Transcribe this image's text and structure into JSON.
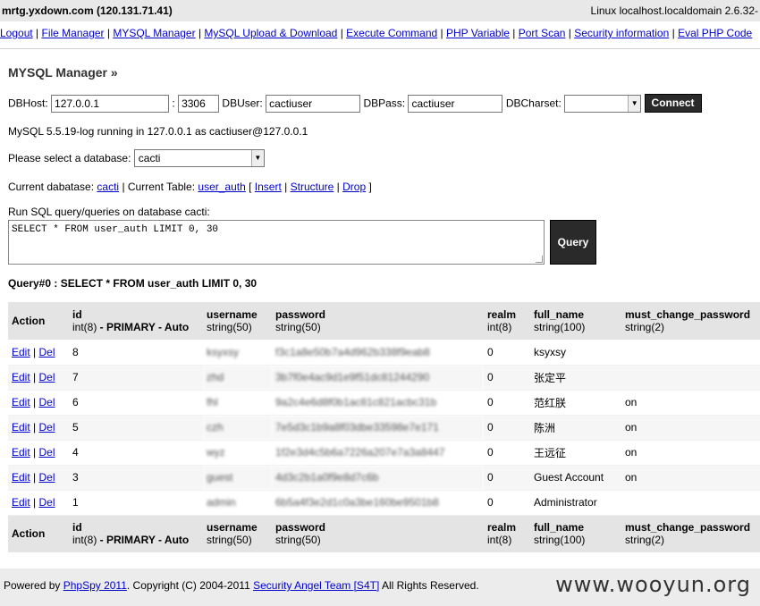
{
  "header": {
    "host": "mrtg.yxdown.com (120.131.71.41)",
    "system": "Linux localhost.localdomain 2.6.32-"
  },
  "nav": [
    "Logout",
    "File Manager",
    "MYSQL Manager",
    "MySQL Upload & Download",
    "Execute Command",
    "PHP Variable",
    "Port Scan",
    "Security information",
    "Eval PHP Code"
  ],
  "page": {
    "title": "MYSQL Manager »"
  },
  "connect": {
    "host_label": "DBHost:",
    "host_value": "127.0.0.1",
    "port_sep": ":",
    "port_value": "3306",
    "user_label": "DBUser:",
    "user_value": "cactiuser",
    "pass_label": "DBPass:",
    "pass_value": "cactiuser",
    "charset_label": "DBCharset:",
    "charset_value": "",
    "connect_button": "Connect"
  },
  "status": "MySQL 5.5.19-log running in 127.0.0.1 as cactiuser@127.0.0.1",
  "dbselect": {
    "label": "Please select a database:",
    "value": "cacti"
  },
  "current": {
    "db_prefix": "Current dabatase:",
    "db": "cacti",
    "table_prefix": "| Current Table:",
    "table": "user_auth",
    "open_bracket": "[",
    "insert": "Insert",
    "pipe1": "|",
    "structure": "Structure",
    "pipe2": "|",
    "drop": "Drop",
    "close_bracket": "]"
  },
  "query": {
    "label": "Run SQL query/queries on database cacti:",
    "text": "SELECT * FROM user_auth LIMIT 0, 30",
    "button": "Query",
    "result_title": "Query#0 : SELECT * FROM user_auth LIMIT 0, 30"
  },
  "table": {
    "action_header": "Action",
    "columns": [
      {
        "name": "id",
        "type_plain": "int(8)",
        "type_bold": " - PRIMARY - Auto"
      },
      {
        "name": "username",
        "type_plain": "string(50)",
        "type_bold": ""
      },
      {
        "name": "password",
        "type_plain": "string(50)",
        "type_bold": ""
      },
      {
        "name": "realm",
        "type_plain": "int(8)",
        "type_bold": ""
      },
      {
        "name": "full_name",
        "type_plain": "string(100)",
        "type_bold": ""
      },
      {
        "name": "must_change_password",
        "type_plain": "string(2)",
        "type_bold": ""
      }
    ],
    "edit_label": "Edit",
    "sep": "|",
    "del_label": "Del",
    "rows": [
      {
        "id": "8",
        "username": "ksyxsy",
        "password": "f3c1a8e50b7a4d962b338f9eab8",
        "realm": "0",
        "full_name": "ksyxsy",
        "must_change": ""
      },
      {
        "id": "7",
        "username": "zhd",
        "password": "3b7f0e4ac9d1e9f51dc81244290",
        "realm": "0",
        "full_name": "张定平",
        "must_change": ""
      },
      {
        "id": "6",
        "username": "fhl",
        "password": "9a2c4e6d8f0b1ac81c821acbc31b",
        "realm": "0",
        "full_name": "范红朕",
        "must_change": "on"
      },
      {
        "id": "5",
        "username": "czh",
        "password": "7e5d3c1b9a8f03dbe33598e7e171",
        "realm": "0",
        "full_name": "陈洲",
        "must_change": "on"
      },
      {
        "id": "4",
        "username": "wyz",
        "password": "1f2e3d4c5b6a7226a207e7a3a8447",
        "realm": "0",
        "full_name": "王远征",
        "must_change": "on"
      },
      {
        "id": "3",
        "username": "guest",
        "password": "4d3c2b1a0f9e8d7c6b",
        "realm": "0",
        "full_name": "Guest Account",
        "must_change": "on"
      },
      {
        "id": "1",
        "username": "admin",
        "password": "6b5a4f3e2d1c0a3be160be9501b8",
        "realm": "0",
        "full_name": "Administrator",
        "must_change": ""
      }
    ]
  },
  "footer": {
    "powered": "Powered by",
    "phpspy": "PhpSpy 2011",
    "copyright": ". Copyright (C) 2004-2011",
    "team": "Security Angel Team [S4T]",
    "rights": "All Rights Reserved.",
    "watermark": "www.wooyun.org"
  }
}
